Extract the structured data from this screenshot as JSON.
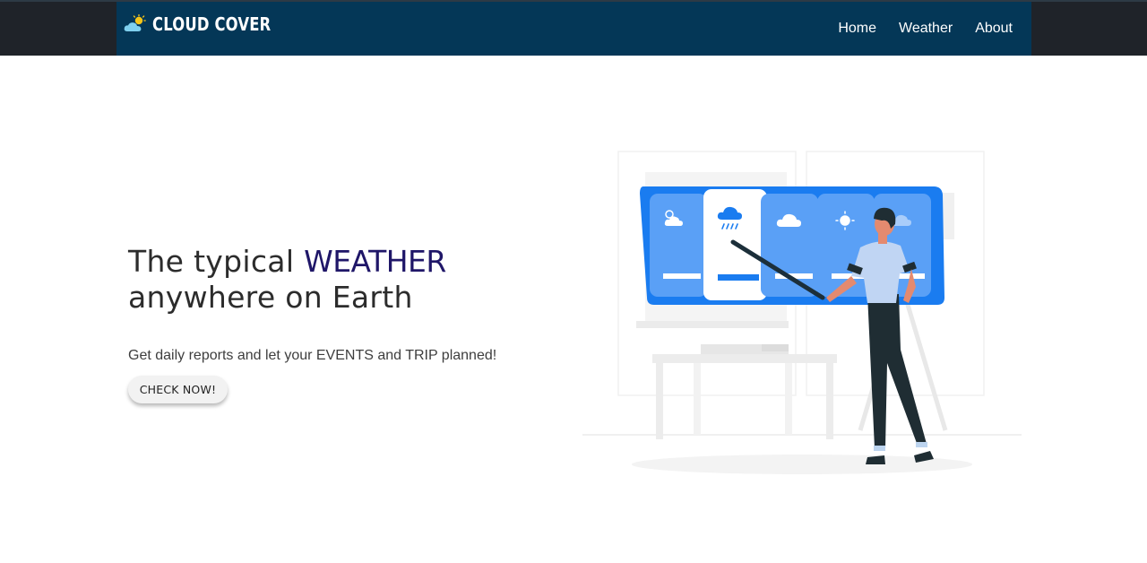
{
  "brand": {
    "name": "CLOUD COVER",
    "logo_icon": "cloud-sun-icon"
  },
  "nav": {
    "items": [
      {
        "label": "Home"
      },
      {
        "label": "Weather"
      },
      {
        "label": "About"
      }
    ]
  },
  "hero": {
    "title_part1": "The typical ",
    "title_highlight": "WEATHER",
    "title_part2": "anywhere on Earth",
    "subtitle": "Get daily reports and let your EVENTS and TRIP planned!",
    "cta_label": "CHECK NOW!"
  },
  "illustration": {
    "subject": "person-presenting-weather-forecast-board",
    "forecast_icons": [
      "partly-cloudy-icon",
      "rain-cloud-icon",
      "cloud-icon",
      "sun-icon",
      "partly-cloudy-icon"
    ]
  },
  "colors": {
    "navbar_bg": "#043757",
    "page_margin_bg": "#1f2329",
    "accent_text": "#1f1668",
    "board_blue": "#1a7cf0",
    "logo_cloud": "#7fd0ee",
    "logo_sun": "#f5c518"
  }
}
